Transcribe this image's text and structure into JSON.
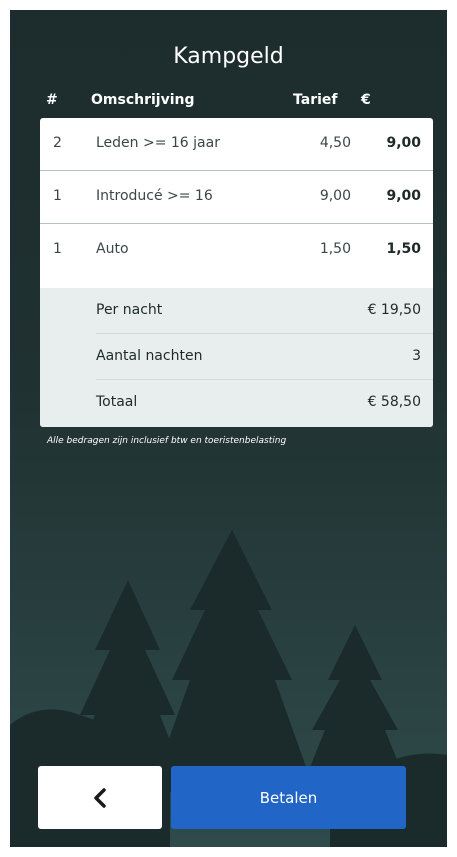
{
  "header": {
    "title": "Kampgeld"
  },
  "columns": {
    "qty": "#",
    "description": "Omschrijving",
    "rate": "Tarief",
    "amount": "€"
  },
  "items": [
    {
      "qty": "2",
      "description": "Leden >= 16 jaar",
      "rate": "4,50",
      "amount": "9,00"
    },
    {
      "qty": "1",
      "description": "Introducé >= 16",
      "rate": "9,00",
      "amount": "9,00"
    },
    {
      "qty": "1",
      "description": "Auto",
      "rate": "1,50",
      "amount": "1,50"
    }
  ],
  "summary": {
    "per_night_label": "Per nacht",
    "per_night_value": "€ 19,50",
    "nights_label": "Aantal nachten",
    "nights_value": "3",
    "total_label": "Totaal",
    "total_value": "€ 58,50"
  },
  "note": "Alle bedragen zijn inclusief btw en toeristenbelasting",
  "actions": {
    "back_icon": "chevron-left-icon",
    "pay_label": "Betalen"
  },
  "colors": {
    "background": "#203131",
    "primary": "#2166c6",
    "card": "#ffffff",
    "summary_bg": "#e8eded"
  }
}
